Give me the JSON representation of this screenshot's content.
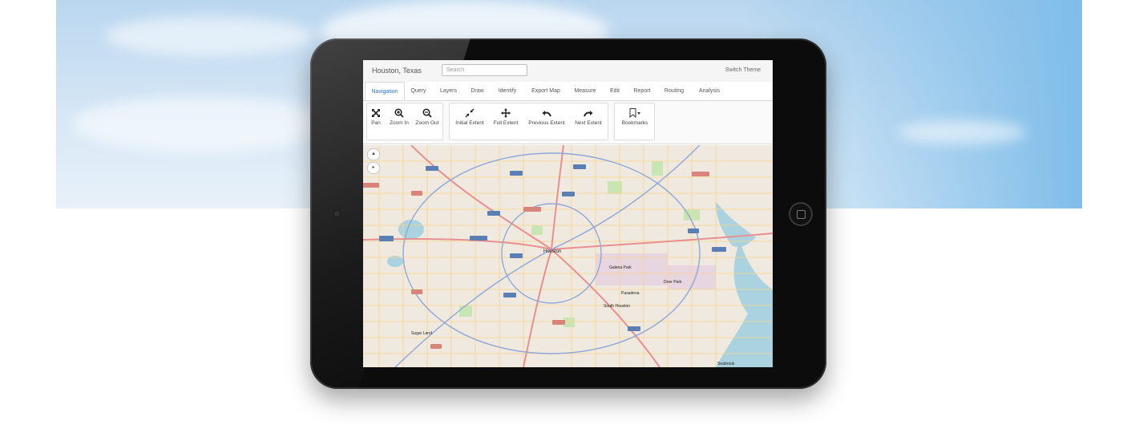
{
  "app": {
    "title": "Houston, Texas",
    "search_placeholder": "Search",
    "switch_theme": "Switch Theme"
  },
  "tabs": [
    {
      "label": "Navigation",
      "active": true
    },
    {
      "label": "Query"
    },
    {
      "label": "Layers"
    },
    {
      "label": "Draw"
    },
    {
      "label": "Identify"
    },
    {
      "label": "Export Map"
    },
    {
      "label": "Measure"
    },
    {
      "label": "Edit"
    },
    {
      "label": "Report"
    },
    {
      "label": "Routing"
    },
    {
      "label": "Analysis"
    }
  ],
  "toolbar": {
    "pan": "Pan",
    "zoom_in": "Zoom In",
    "zoom_out": "Zoom Out",
    "initial_extent": "Initial Extent",
    "full_extent": "Full Extent",
    "previous_extent": "Previous Extent",
    "next_extent": "Next Extent",
    "bookmarks": "Bookmarks"
  },
  "map": {
    "labels": {
      "city": "Houston",
      "pasadena": "Pasadena",
      "deer_park": "Deer Park",
      "south_houston": "South Houston",
      "galena_park": "Galena Park",
      "sugar_land": "Sugar Land",
      "seabrook": "Seabrook"
    },
    "colors": {
      "water": "#aad3df",
      "park": "#c8e6b4",
      "highway": "#e88f8f",
      "road": "#f7d58c"
    }
  }
}
